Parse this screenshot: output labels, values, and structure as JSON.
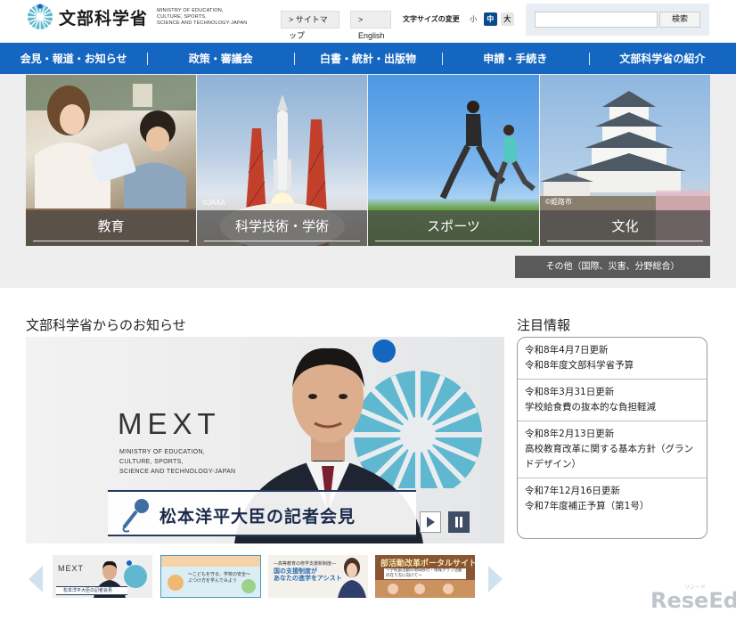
{
  "header": {
    "logo_jp": "文部科学省",
    "logo_en": [
      "MINISTRY OF EDUCATION,",
      "CULTURE, SPORTS,",
      "SCIENCE AND TECHNOLOGY-JAPAN"
    ],
    "sitemap_label": "> サイトマップ",
    "english_label": "> English",
    "fontsize_label": "文字サイズの変更",
    "fontsize_small": "小",
    "fontsize_mid": "中",
    "fontsize_large": "大",
    "search_placeholder": "",
    "search_button": "検索"
  },
  "nav": {
    "items": [
      "会見・報道・お知らせ",
      "政策・審議会",
      "白書・統計・出版物",
      "申請・手続き",
      "文部科学省の紹介"
    ]
  },
  "hero": {
    "tiles": [
      {
        "label": "教育",
        "credit": ""
      },
      {
        "label": "科学技術・学術",
        "credit": "©JAXA"
      },
      {
        "label": "スポーツ",
        "credit": ""
      },
      {
        "label": "文化",
        "credit": "©姫路市"
      }
    ],
    "other_label": "その他（国際、災害、分野総合）"
  },
  "news": {
    "title": "文部科学省からのお知らせ",
    "banner": {
      "mext_word": "MEXT",
      "mext_sub": [
        "MINISTRY OF EDUCATION,",
        "CULTURE, SPORTS,",
        "SCIENCE AND TECHNOLOGY-JAPAN"
      ],
      "press_text": "松本洋平大臣の記者会見"
    },
    "thumbs": [
      {
        "mext": "MEXT",
        "band": "松本洋平大臣の記者会見"
      },
      {
        "text": [
          "〜こどもを守る、学校の安全〜",
          "ぶつけ方を学んでみよう"
        ]
      },
      {
        "small": "―高等教育の修学支援新制度―",
        "big": "国の支援制度が",
        "big2": "あなたの進学をアシスト"
      },
      {
        "title": "部活動改革ポータルサイト",
        "sub": "〜学校部活動の地域移行・地域クラブ活動の在り方に向けて〜"
      }
    ]
  },
  "focus": {
    "title": "注目情報",
    "items": [
      {
        "date": "令和8年4月7日更新",
        "text": "令和8年度文部科学省予算"
      },
      {
        "date": "令和8年3月31日更新",
        "text": "学校給食費の抜本的な負担軽減"
      },
      {
        "date": "令和8年2月13日更新",
        "text": "高校教育改革に関する基本方針（グランドデザイン）"
      },
      {
        "date": "令和7年12月16日更新",
        "text": "令和7年度補正予算（第1号）"
      }
    ]
  },
  "watermark": {
    "text": "ReseEd",
    "sub": "リシード"
  },
  "colors": {
    "nav": "#1566c0",
    "accent": "#0a4b8f",
    "other_btn": "#5a5a5a"
  }
}
